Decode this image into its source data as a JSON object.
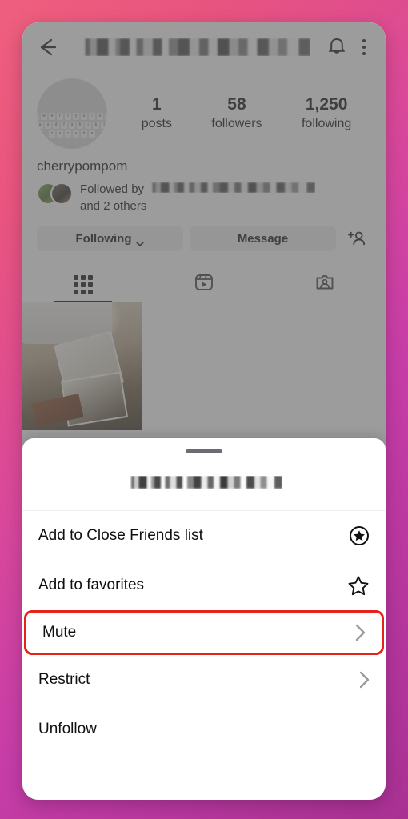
{
  "theme": {
    "background_gradient_from": "#ef5f7e",
    "background_gradient_to": "#a93194",
    "highlight_color": "#e5231b",
    "text_color": "#0c0c0c",
    "button_bg": "#efefef"
  },
  "topbar": {
    "back_icon": "back-arrow-icon",
    "title_blurred": "",
    "bell_icon": "bell-icon",
    "overflow_icon": "three-dots-icon"
  },
  "profile": {
    "avatar_alt": "keyboard-avatar",
    "keyboard_rows": [
      "qwertyuiop",
      "asdfghjkl",
      "zxcvbn"
    ],
    "stats": [
      {
        "number": "1",
        "label": "posts"
      },
      {
        "number": "58",
        "label": "followers"
      },
      {
        "number": "1,250",
        "label": "following"
      }
    ],
    "fullname": "cherrypompom",
    "followed_by_prefix": "Followed by",
    "followed_by_suffix": "and 2 others",
    "actions": {
      "following_label": "Following",
      "message_label": "Message",
      "add_person_icon": "add-person-icon"
    },
    "tabs": [
      {
        "name": "grid",
        "icon": "grid-icon",
        "active": true
      },
      {
        "name": "reels",
        "icon": "reels-icon",
        "active": false
      },
      {
        "name": "tagged",
        "icon": "tagged-icon",
        "active": false
      }
    ]
  },
  "sheet": {
    "handle": "drag-handle",
    "title_blurred": "",
    "items": [
      {
        "label": "Add to Close Friends list",
        "trailing": "close-friends-star-icon",
        "highlighted": false
      },
      {
        "label": "Add to favorites",
        "trailing": "star-outline-icon",
        "highlighted": false
      },
      {
        "label": "Mute",
        "trailing": "chevron-right-icon",
        "highlighted": true
      },
      {
        "label": "Restrict",
        "trailing": "chevron-right-icon",
        "highlighted": false
      },
      {
        "label": "Unfollow",
        "trailing": "",
        "highlighted": false
      }
    ]
  }
}
